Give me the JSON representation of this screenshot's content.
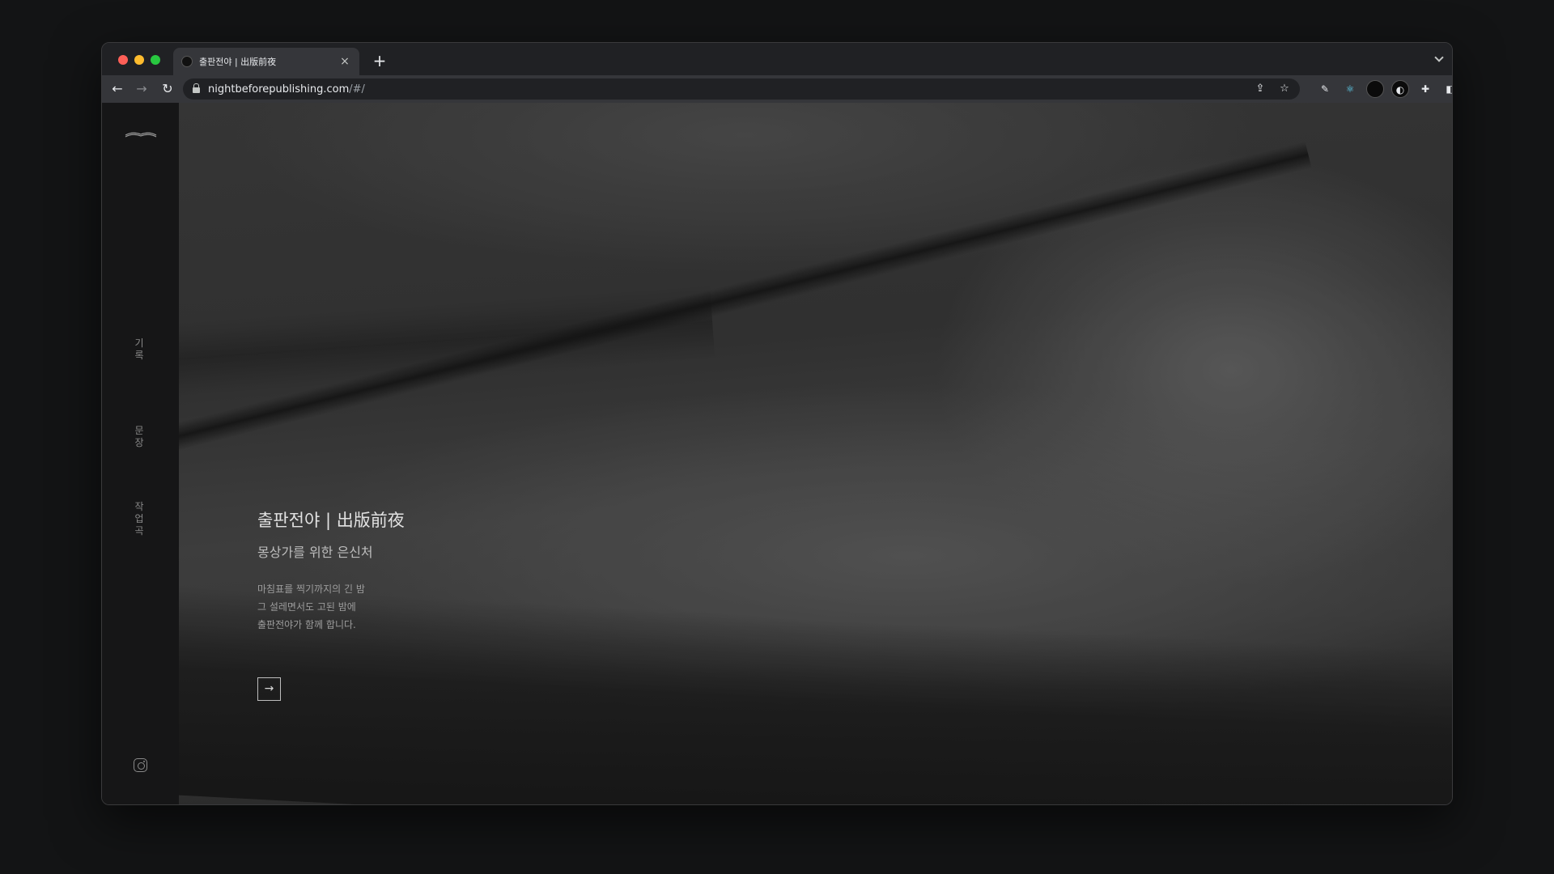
{
  "browser": {
    "tab_title": "출판전야 | 出版前夜",
    "tab_close": "×",
    "new_tab": "+",
    "url_host": "nightbeforepublishing.com",
    "url_path": "/#/"
  },
  "nav_icons": {
    "back": "←",
    "forward": "→",
    "reload": "↻",
    "share": "⇪",
    "bookmark": "☆",
    "puzzle": "✚",
    "sidepanel": "◧",
    "menu": "⋮"
  },
  "sidebar": {
    "items": [
      {
        "label": "기록"
      },
      {
        "label": "문장"
      },
      {
        "label": "작업곡"
      }
    ]
  },
  "hero": {
    "title": "출판전야 | 出版前夜",
    "subtitle": "몽상가를 위한 은신처",
    "body": [
      "마침표를 찍기까지의 긴 밤",
      "그 설레면서도 고된 밤에",
      "출판전야가 함께 합니다."
    ],
    "arrow": "→"
  },
  "colors": {
    "window_bg": "#202124",
    "toolbar_bg": "#35363a",
    "sidebar_bg": "#161617"
  }
}
